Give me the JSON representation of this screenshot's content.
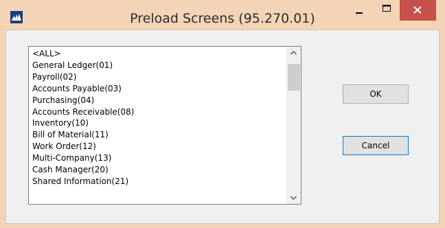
{
  "window": {
    "title": "Preload Screens (95.270.01)",
    "icons": {
      "app": "app-logo-icon",
      "minimize": "minimize-icon",
      "maximize": "maximize-icon",
      "close": "close-icon"
    },
    "colors": {
      "frame": "#f4d4b6",
      "close_button": "#c7504b",
      "focus_border": "#0078d7"
    }
  },
  "listbox": {
    "items": [
      "<ALL>",
      "General Ledger(01)",
      "Payroll(02)",
      "Accounts Payable(03)",
      "Purchasing(04)",
      "Accounts Receivable(08)",
      "Inventory(10)",
      "Bill of Material(11)",
      "Work Order(12)",
      "Multi-Company(13)",
      "Cash Manager(20)",
      "Shared Information(21)"
    ],
    "scroll_icons": {
      "up": "chevron-up-icon",
      "down": "chevron-down-icon"
    }
  },
  "buttons": {
    "ok_label": "OK",
    "cancel_label": "Cancel"
  }
}
